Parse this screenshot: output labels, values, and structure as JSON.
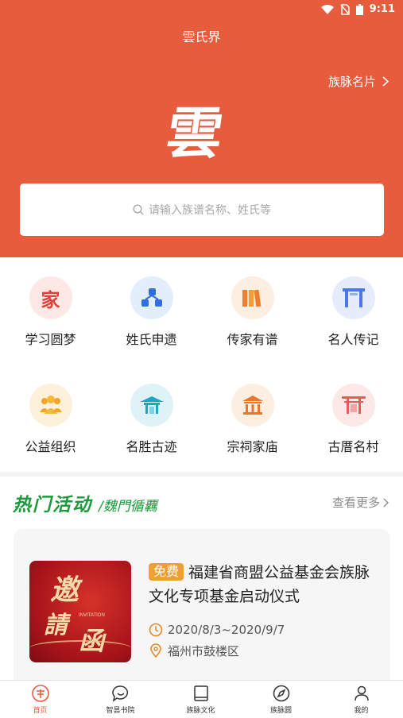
{
  "status_bar": {
    "time": "9:11"
  },
  "header": {
    "app_title": "雲氏界",
    "card_link": "族脉名片",
    "logo_char": "雲",
    "bg_color": "#e65c3c"
  },
  "search": {
    "placeholder": "请输入族谱名称、姓氏等"
  },
  "grid": {
    "row1": [
      {
        "label": "学习圆梦",
        "icon": "family-char-icon"
      },
      {
        "label": "姓氏申遗",
        "icon": "network-icon"
      },
      {
        "label": "传家有谱",
        "icon": "books-icon"
      },
      {
        "label": "名人传记",
        "icon": "archway-icon"
      }
    ],
    "row2": [
      {
        "label": "公益组织",
        "icon": "people-icon"
      },
      {
        "label": "名胜古迹",
        "icon": "pavilion-icon"
      },
      {
        "label": "宗祠家庙",
        "icon": "temple-icon"
      },
      {
        "label": "古厝名村",
        "icon": "torii-icon"
      }
    ]
  },
  "hot": {
    "title": "热门活动",
    "subtitle": "/魏門循覊",
    "more": "查看更多"
  },
  "activity": {
    "badge": "免费",
    "title": "福建省商盟公益基金会族脉文化专项基金启动仪式",
    "date": "2020/8/3~2020/9/7",
    "location": "福州市鼓楼区",
    "poster_text": "邀請函",
    "poster_small": "INVITATION"
  },
  "tabs": [
    {
      "label": "首页",
      "icon": "home-seal-icon",
      "active": true
    },
    {
      "label": "智昙书院",
      "icon": "chat-bubble-icon",
      "active": false
    },
    {
      "label": "族脉文化",
      "icon": "book-icon",
      "active": false
    },
    {
      "label": "族脉圆",
      "icon": "compass-icon",
      "active": false
    },
    {
      "label": "我的",
      "icon": "user-icon",
      "active": false
    }
  ]
}
